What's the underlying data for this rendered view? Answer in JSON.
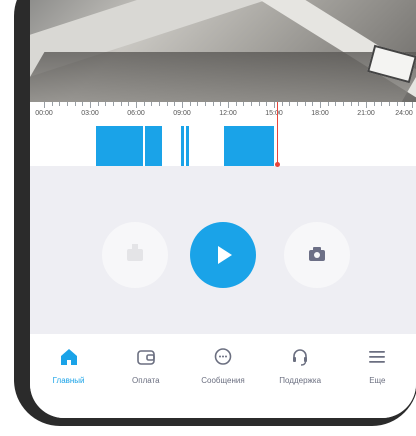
{
  "timeline": {
    "labels": [
      "00:00",
      "03:00",
      "06:00",
      "09:00",
      "12:00",
      "15:00",
      "18:00",
      "21:00",
      "24:00"
    ]
  },
  "controls": {
    "ptz_icon": "ptz-icon",
    "play_icon": "play-icon",
    "snapshot_icon": "camera-icon",
    "accent": "#1aa3e8"
  },
  "nav": {
    "items": [
      {
        "label": "Главный",
        "icon": "home-icon",
        "active": true
      },
      {
        "label": "Оплата",
        "icon": "wallet-icon",
        "active": false
      },
      {
        "label": "Сообщения",
        "icon": "chat-icon",
        "active": false
      },
      {
        "label": "Поддержка",
        "icon": "headset-icon",
        "active": false
      },
      {
        "label": "Еще",
        "icon": "menu-icon",
        "active": false
      }
    ]
  }
}
